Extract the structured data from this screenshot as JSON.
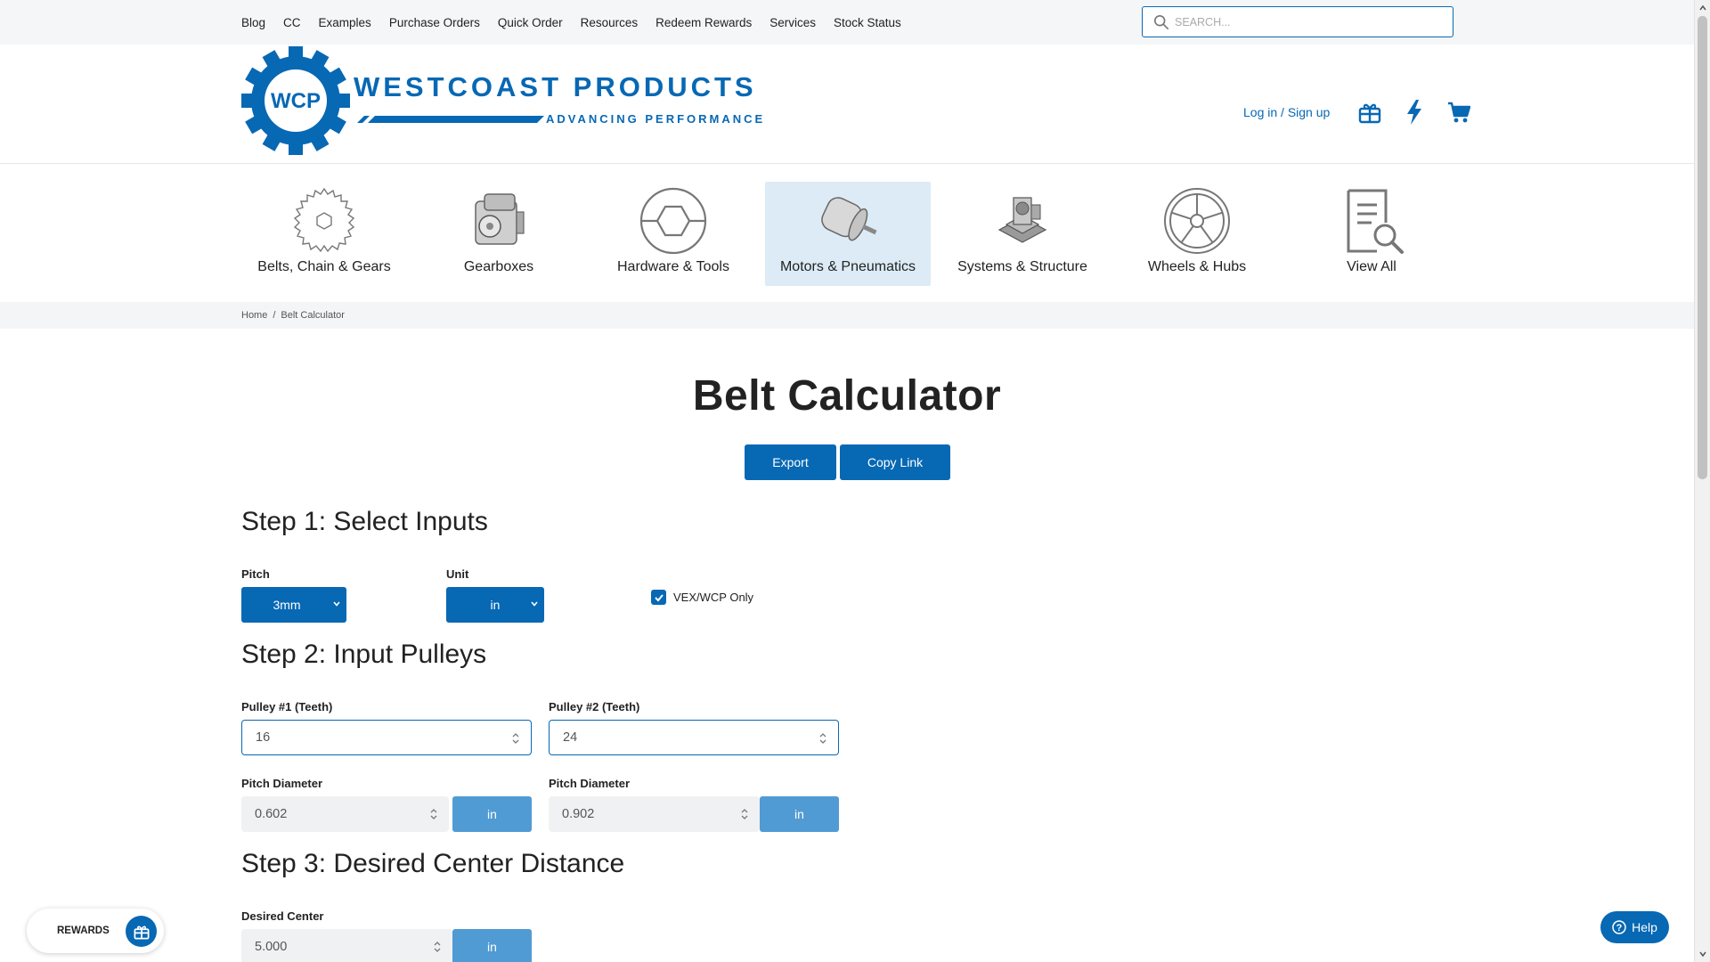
{
  "topnav": [
    "Blog",
    "CC",
    "Examples",
    "Purchase Orders",
    "Quick Order",
    "Resources",
    "Redeem Rewards",
    "Services",
    "Stock Status"
  ],
  "search": {
    "placeholder": "SEARCH..."
  },
  "logo": {
    "mark": "WCP",
    "name": "WESTCOAST PRODUCTS",
    "tagline": "ADVANCING PERFORMANCE"
  },
  "account": {
    "login_label": "Log in / Sign up",
    "icons": [
      "gift-icon",
      "lightning-icon",
      "cart-icon"
    ]
  },
  "categories": [
    {
      "label": "Belts, Chain & Gears",
      "icon": "gear-icon",
      "active": false
    },
    {
      "label": "Gearboxes",
      "icon": "gearbox-icon",
      "active": false
    },
    {
      "label": "Hardware & Tools",
      "icon": "hex-shaft-icon",
      "active": false
    },
    {
      "label": "Motors & Pneumatics",
      "icon": "motor-icon",
      "active": true
    },
    {
      "label": "Systems & Structure",
      "icon": "structure-icon",
      "active": false
    },
    {
      "label": "Wheels & Hubs",
      "icon": "wheel-icon",
      "active": false
    },
    {
      "label": "View All",
      "icon": "document-search-icon",
      "active": false
    }
  ],
  "breadcrumb": {
    "home": "Home",
    "separator": "/",
    "current": "Belt Calculator"
  },
  "page": {
    "title": "Belt Calculator",
    "export_label": "Export",
    "copy_link_label": "Copy Link"
  },
  "step1": {
    "heading": "Step 1: Select Inputs",
    "pitch_label": "Pitch",
    "pitch_value": "3mm",
    "unit_label": "Unit",
    "unit_value": "in",
    "vex_label": "VEX/WCP Only",
    "vex_checked": true
  },
  "step2": {
    "heading": "Step 2: Input Pulleys",
    "pulley1_label": "Pulley #1 (Teeth)",
    "pulley1_value": "16",
    "pulley2_label": "Pulley #2 (Teeth)",
    "pulley2_value": "24",
    "pd1_label": "Pitch Diameter",
    "pd1_value": "0.602",
    "pd1_unit": "in",
    "pd2_label": "Pitch Diameter",
    "pd2_value": "0.902",
    "pd2_unit": "in"
  },
  "step3": {
    "heading": "Step 3: Desired Center Distance",
    "center_label": "Desired Center",
    "center_value": "5.000",
    "center_unit": "in"
  },
  "widgets": {
    "rewards_label": "REWARDS",
    "help_label": "Help"
  },
  "colors": {
    "brand": "#0768b4",
    "unit_button": "#519bd4",
    "active_category": "#dcebf5"
  }
}
